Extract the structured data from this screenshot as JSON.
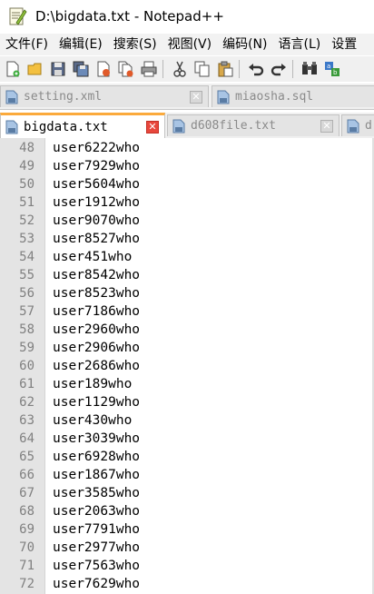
{
  "window": {
    "title": "D:\\bigdata.txt - Notepad++"
  },
  "menu": [
    {
      "label": "文件(F)"
    },
    {
      "label": "编辑(E)"
    },
    {
      "label": "搜索(S)"
    },
    {
      "label": "视图(V)"
    },
    {
      "label": "编码(N)"
    },
    {
      "label": "语言(L)"
    },
    {
      "label": "设置"
    }
  ],
  "toolbar": {
    "icons": [
      "new-file-icon",
      "open-folder-icon",
      "save-icon",
      "save-all-icon",
      "close-icon",
      "close-all-icon",
      "print-icon",
      "cut-icon",
      "copy-icon",
      "paste-icon",
      "undo-icon",
      "redo-icon",
      "find-icon",
      "replace-icon"
    ]
  },
  "tabs_row1": [
    {
      "label": "setting.xml"
    },
    {
      "label": "miaosha.sql"
    }
  ],
  "tabs_row2": [
    {
      "label": "bigdata.txt",
      "active": true
    },
    {
      "label": "d608file.txt"
    },
    {
      "label": "d"
    }
  ],
  "colors": {
    "active_tab_accent": "#fbaa3c",
    "close_active": "#e8473c",
    "gutter_bg": "#e4e4e4"
  },
  "editor": {
    "lines": [
      {
        "num": "48",
        "text": "user6222who"
      },
      {
        "num": "49",
        "text": "user7929who"
      },
      {
        "num": "50",
        "text": "user5604who"
      },
      {
        "num": "51",
        "text": "user1912who"
      },
      {
        "num": "52",
        "text": "user9070who"
      },
      {
        "num": "53",
        "text": "user8527who"
      },
      {
        "num": "54",
        "text": "user451who"
      },
      {
        "num": "55",
        "text": "user8542who"
      },
      {
        "num": "56",
        "text": "user8523who"
      },
      {
        "num": "57",
        "text": "user7186who"
      },
      {
        "num": "58",
        "text": "user2960who"
      },
      {
        "num": "59",
        "text": "user2906who"
      },
      {
        "num": "60",
        "text": "user2686who"
      },
      {
        "num": "61",
        "text": "user189who"
      },
      {
        "num": "62",
        "text": "user1129who"
      },
      {
        "num": "63",
        "text": "user430who"
      },
      {
        "num": "64",
        "text": "user3039who"
      },
      {
        "num": "65",
        "text": "user6928who"
      },
      {
        "num": "66",
        "text": "user1867who"
      },
      {
        "num": "67",
        "text": "user3585who"
      },
      {
        "num": "68",
        "text": "user2063who"
      },
      {
        "num": "69",
        "text": "user7791who"
      },
      {
        "num": "70",
        "text": "user2977who"
      },
      {
        "num": "71",
        "text": "user7563who"
      },
      {
        "num": "72",
        "text": "user7629who"
      }
    ]
  }
}
